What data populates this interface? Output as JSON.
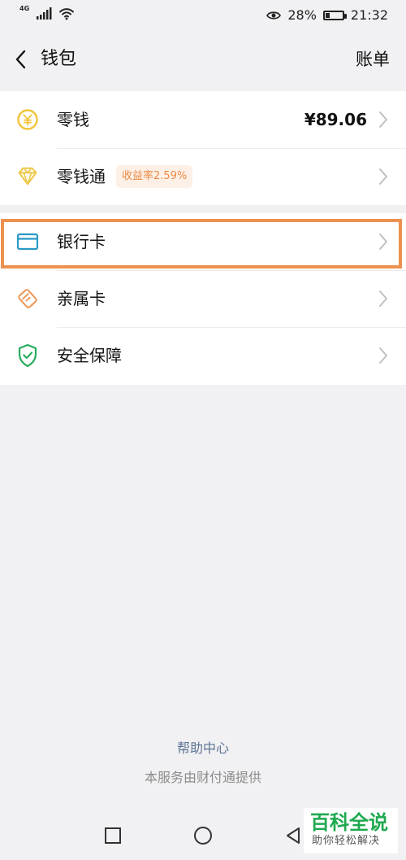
{
  "status_bar": {
    "network": "4G",
    "battery_level": 0.28,
    "battery_text": "28%",
    "time": "21:32",
    "icons": [
      "signal-icon",
      "wifi-icon",
      "eye-icon",
      "battery-icon"
    ]
  },
  "header": {
    "title": "钱包",
    "action": "账单",
    "icons": [
      "back-icon"
    ]
  },
  "wallet": {
    "items": [
      {
        "label": "零钱",
        "value": "¥89.06",
        "icon": "coin-icon",
        "accent": "#f1c43a"
      },
      {
        "label": "零钱通",
        "badge": "收益率2.59%",
        "icon": "diamond-icon",
        "accent": "#efc84b"
      }
    ]
  },
  "services": {
    "items": [
      {
        "label": "银行卡",
        "icon": "card-icon",
        "accent": "#2a9ac6"
      },
      {
        "label": "亲属卡",
        "icon": "family-card-icon",
        "accent": "#ec9857"
      },
      {
        "label": "安全保障",
        "icon": "shield-icon",
        "accent": "#27ae5b"
      }
    ]
  },
  "footer": {
    "help": "帮助中心",
    "service": "本服务由财付通提供"
  },
  "watermark": {
    "main": "百科全说",
    "sub": "助你轻松解决"
  },
  "colors": {
    "highlight": "#ed914f",
    "badge_text": "#ec8b47",
    "badge_bg": "#fdf0e6",
    "help_link": "#5c7393"
  }
}
